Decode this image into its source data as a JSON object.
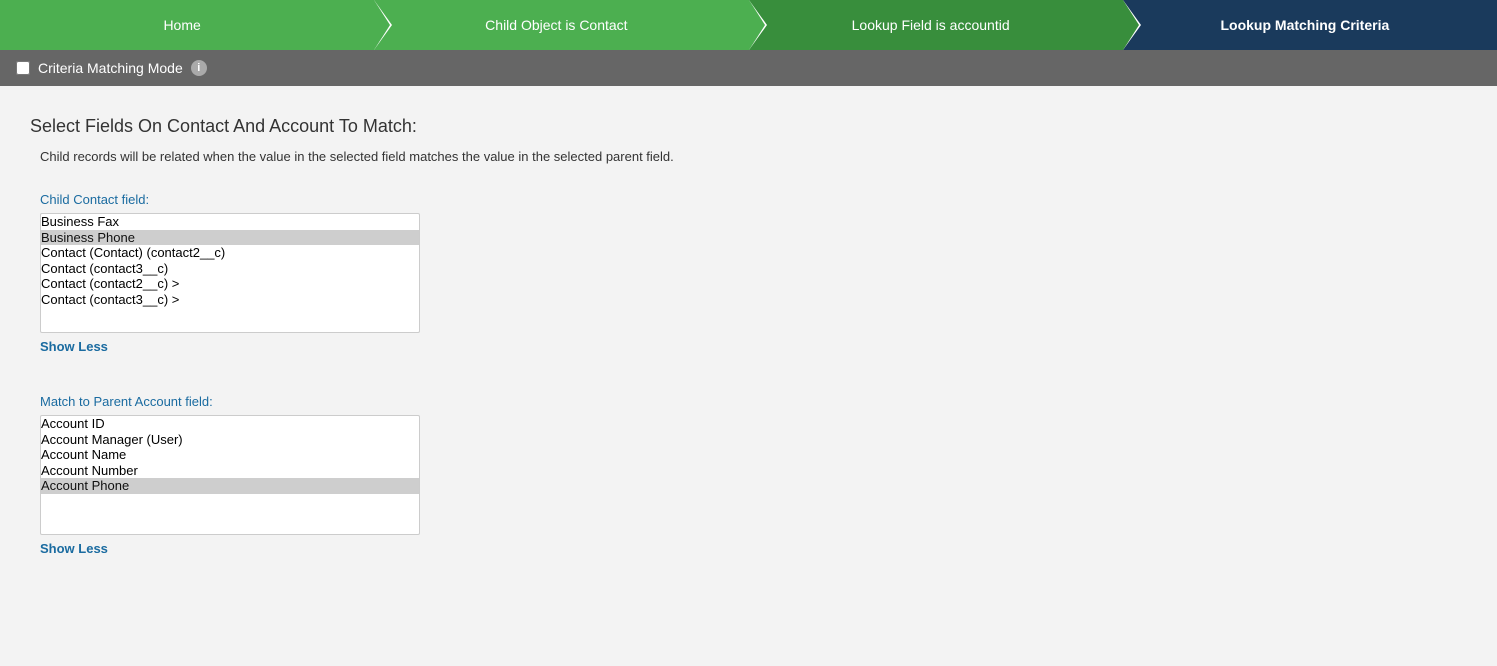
{
  "breadcrumb": {
    "items": [
      {
        "id": "home",
        "label": "Home",
        "style": "bc-green"
      },
      {
        "id": "child-object",
        "label": "Child Object is Contact",
        "style": "bc-green"
      },
      {
        "id": "lookup-field",
        "label": "Lookup Field is accountid",
        "style": "bc-dark-green"
      },
      {
        "id": "lookup-criteria",
        "label": "Lookup Matching Criteria",
        "style": "bc-navy"
      }
    ]
  },
  "criteria_bar": {
    "checkbox_label": "Criteria Matching Mode",
    "info_icon": "i"
  },
  "main": {
    "section_title": "Select Fields On Contact And Account To Match:",
    "description": {
      "part1": "Child records will be related when the value in the selected field matches the value in the selected parent field."
    },
    "child_field": {
      "label": "Child Contact field:",
      "items": [
        {
          "id": "business-fax",
          "text": "Business Fax",
          "selected": false
        },
        {
          "id": "business-phone",
          "text": "Business Phone",
          "selected": true
        },
        {
          "id": "contact-contact2c",
          "text": "Contact (Contact) (contact2__c)",
          "selected": false
        },
        {
          "id": "contact-contact3c",
          "text": "Contact (contact3__c)",
          "selected": false
        },
        {
          "id": "contact-contact2c-arrow",
          "text": "Contact (contact2__c) >",
          "selected": false
        },
        {
          "id": "contact-contact3c-arrow",
          "text": "Contact (contact3__c) >",
          "selected": false
        }
      ],
      "show_less_label": "Show Less"
    },
    "parent_field": {
      "label": "Match to Parent Account field:",
      "items": [
        {
          "id": "account-id",
          "text": "Account ID",
          "selected": false
        },
        {
          "id": "account-manager",
          "text": "Account Manager (User)",
          "selected": false
        },
        {
          "id": "account-name",
          "text": "Account Name",
          "selected": false
        },
        {
          "id": "account-number",
          "text": "Account Number",
          "selected": false
        },
        {
          "id": "account-phone",
          "text": "Account Phone",
          "selected": true
        }
      ],
      "show_less_label": "Show Less"
    }
  }
}
